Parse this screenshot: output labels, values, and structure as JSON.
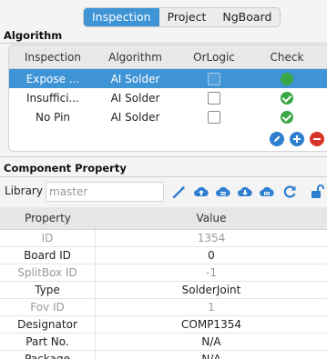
{
  "tabs": [
    {
      "label": "Inspection",
      "active": true
    },
    {
      "label": "Project",
      "active": false
    },
    {
      "label": "NgBoard",
      "active": false
    }
  ],
  "algorithm": {
    "title": "Algorithm",
    "columns": [
      "Inspection",
      "Algorithm",
      "OrLogic",
      "Check"
    ],
    "rows": [
      {
        "inspection": "Expose ...",
        "algorithm": "AI Solder",
        "orlogic": false,
        "check": "ok",
        "selected": true
      },
      {
        "inspection": "Insuffici...",
        "algorithm": "AI Solder",
        "orlogic": false,
        "check": "ok",
        "selected": false
      },
      {
        "inspection": "No Pin",
        "algorithm": "AI Solder",
        "orlogic": false,
        "check": "ok",
        "selected": false
      }
    ]
  },
  "component": {
    "title": "Component Property",
    "library_label": "Library",
    "library_placeholder": "master",
    "columns": [
      "Property",
      "Value"
    ],
    "rows": [
      {
        "property": "ID",
        "value": "1354",
        "readonly": true
      },
      {
        "property": "Board ID",
        "value": "0",
        "readonly": false
      },
      {
        "property": "SplitBox ID",
        "value": "-1",
        "readonly": true
      },
      {
        "property": "Type",
        "value": "SolderJoint",
        "readonly": false
      },
      {
        "property": "Fov ID",
        "value": "1",
        "readonly": true
      },
      {
        "property": "Designator",
        "value": "COMP1354",
        "readonly": false
      },
      {
        "property": "Part No.",
        "value": "N/A",
        "readonly": false
      },
      {
        "property": "Package",
        "value": "N/A",
        "readonly": false
      }
    ]
  },
  "colors": {
    "accent": "#3f94d6",
    "ok": "#3aa646",
    "danger": "#d9342b"
  }
}
